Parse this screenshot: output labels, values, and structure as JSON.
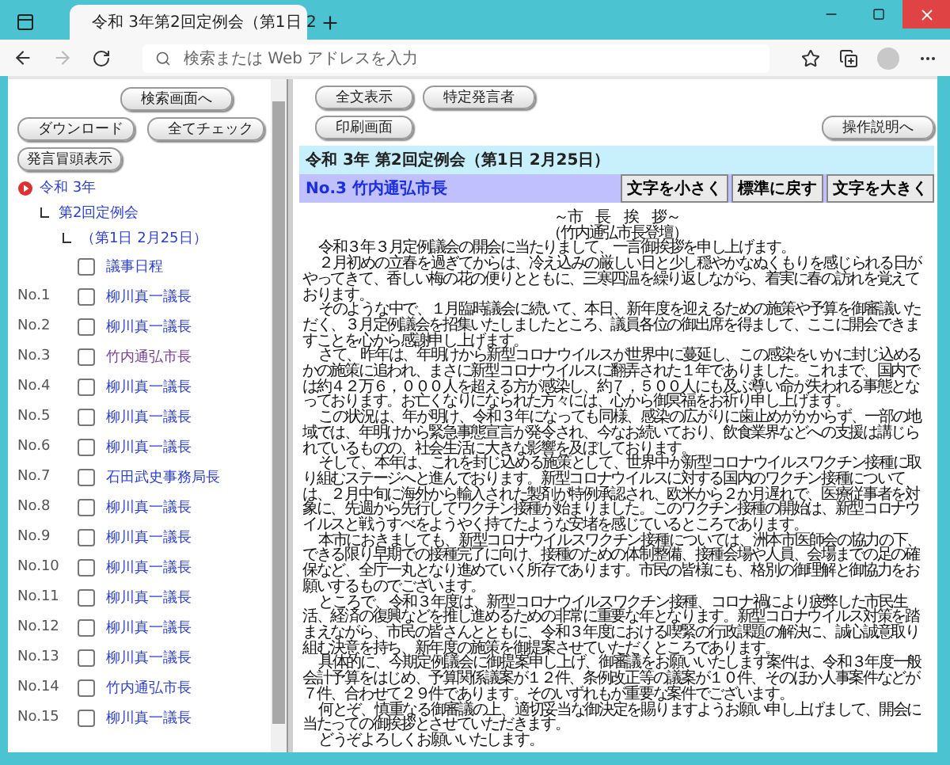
{
  "browser": {
    "tab_title": "令和 3年第2回定例会（第1日 2",
    "address_placeholder": "検索または Web アドレスを入力"
  },
  "sidebar": {
    "search_button": "検索画面へ",
    "action_buttons": [
      "ダウンロード",
      "全てチェック"
    ],
    "toggle_button": "発言冒頭表示",
    "tree": [
      {
        "label": "令和 3年",
        "children": [
          {
            "label": "第2回定例会",
            "children": [
              {
                "label": "（第1日 2月25日）"
              }
            ]
          }
        ]
      }
    ],
    "items": [
      {
        "label": "議事日程",
        "checked": false,
        "selected": false
      },
      {
        "number": "No.1",
        "label": "柳川真一議長",
        "checked": false,
        "selected": false
      },
      {
        "number": "No.2",
        "label": "柳川真一議長",
        "checked": false,
        "selected": false
      },
      {
        "number": "No.3",
        "label": "竹内通弘市長",
        "checked": false,
        "selected": true
      },
      {
        "number": "No.4",
        "label": "柳川真一議長",
        "checked": false,
        "selected": false
      },
      {
        "number": "No.5",
        "label": "柳川真一議長",
        "checked": false,
        "selected": false
      },
      {
        "number": "No.6",
        "label": "柳川真一議長",
        "checked": false,
        "selected": false
      },
      {
        "number": "No.7",
        "label": "石田武史事務局長",
        "checked": false,
        "selected": false
      },
      {
        "number": "No.8",
        "label": "柳川真一議長",
        "checked": false,
        "selected": false
      },
      {
        "number": "No.9",
        "label": "柳川真一議長",
        "checked": false,
        "selected": false
      },
      {
        "number": "No.10",
        "label": "柳川真一議長",
        "checked": false,
        "selected": false
      },
      {
        "number": "No.11",
        "label": "柳川真一議長",
        "checked": false,
        "selected": false
      },
      {
        "number": "No.12",
        "label": "柳川真一議長",
        "checked": false,
        "selected": false
      },
      {
        "number": "No.13",
        "label": "柳川真一議長",
        "checked": false,
        "selected": false
      },
      {
        "number": "No.14",
        "label": "竹内通弘市長",
        "checked": false,
        "selected": false
      },
      {
        "number": "No.15",
        "label": "柳川真一議長",
        "checked": false,
        "selected": false
      }
    ]
  },
  "main": {
    "view_buttons": [
      "全文表示",
      "特定発言者"
    ],
    "print_button": "印刷画面",
    "help_button": "操作説明へ",
    "meeting_title": "令和 3年 第2回定例会（第1日 2月25日）",
    "speaker": "No.3 竹内通弘市長",
    "font_buttons": [
      "文字を小さく",
      "標準に戻す",
      "文字を大きく"
    ],
    "speech": {
      "heading": "～市　長　挨　拶～",
      "subheading": "（竹内通弘市長登壇）",
      "paragraphs": [
        "令和３年３月定例議会の開会に当たりまして、一言御挨拶を申し上げます。",
        "２月初めの立春を過ぎてからは、冷え込みの厳しい日と少し穏やかなぬくもりを感じられる日がやってきて、香しい梅の花の便りとともに、三寒四温を繰り返しながら、着実に春の訪れを覚えております。",
        "そのような中で、１月臨時議会に続いて、本日、新年度を迎えるための施策や予算を御審議いただく、３月定例議会を招集いたしましたところ、議員各位の御出席を得まして、ここに開会できますことを心から感謝申し上げます。",
        "さて、昨年は、年明けから新型コロナウイルスが世界中に蔓延し、この感染をいかに封じ込めるかの施策に追われ、まさに新型コロナウイルスに翻弄された１年でありました。これまで、国内では約４２万６，０００人を超える方が感染し、約７，５００人にも及ぶ尊い命が失われる事態となっております。お亡くなりになられた方々には、心から御冥福をお祈り申し上げます。",
        "この状況は、年が明け、令和３年になっても同様、感染の広がりに歯止めがかからず、一部の地域では、年明けから緊急事態宣言が発令され、今なお続いており、飲食業界などへの支援は講じられているものの、社会生活に大きな影響を及ぼしております。",
        "そして、本年は、これを封じ込める施策として、世界中が新型コロナウイルスワクチン接種に取り組むステージへと進んでおります。新型コロナウイルスに対する国内のワクチン接種については、２月中旬に海外から輸入された製剤が特例承認され、欧米から２か月遅れで、医療従事者を対象に、先週から先行してワクチン接種が始まりました。このワクチン接種の開始は、新型コロナウイルスと戦うすべをようやく持てたような安堵を感じているところであります。",
        "本市におきましても、新型コロナウイルスワクチン接種については、洲本市医師会の協力の下、できる限り早期での接種完了に向け、接種のための体制整備、接種会場や人員、会場までの足の確保など、全庁一丸となり進めていく所存であります。市民の皆様にも、格別の御理解と御協力をお願いするものでございます。",
        "ところで、令和３年度は、新型コロナウイルスワクチン接種、コロナ禍により疲弊した市民生活、経済の復興などを推し進めるための非常に重要な年となります。新型コロナウイルス対策を踏まえながら、市民の皆さんとともに、令和３年度における喫緊の行政課題の解決に、誠心誠意取り組む決意を持ち、新年度の施策を御提案させていただくところであります。",
        "具体的に、今期定例議会に御提案申し上げ、御審議をお願いいたします案件は、令和３年度一般会計予算をはじめ、予算関係議案が１２件、条例改正等の議案が１０件、そのほか人事案件などが７件、合わせて２９件であります。そのいずれもが重要な案件でございます。",
        "何とぞ、慎重なる御審議の上、適切妥当な御決定を賜りますようお願い申し上げまして、開会に当たっての御挨拶とさせていただきます。",
        "どうぞよろしくお願いいたします。"
      ]
    }
  }
}
